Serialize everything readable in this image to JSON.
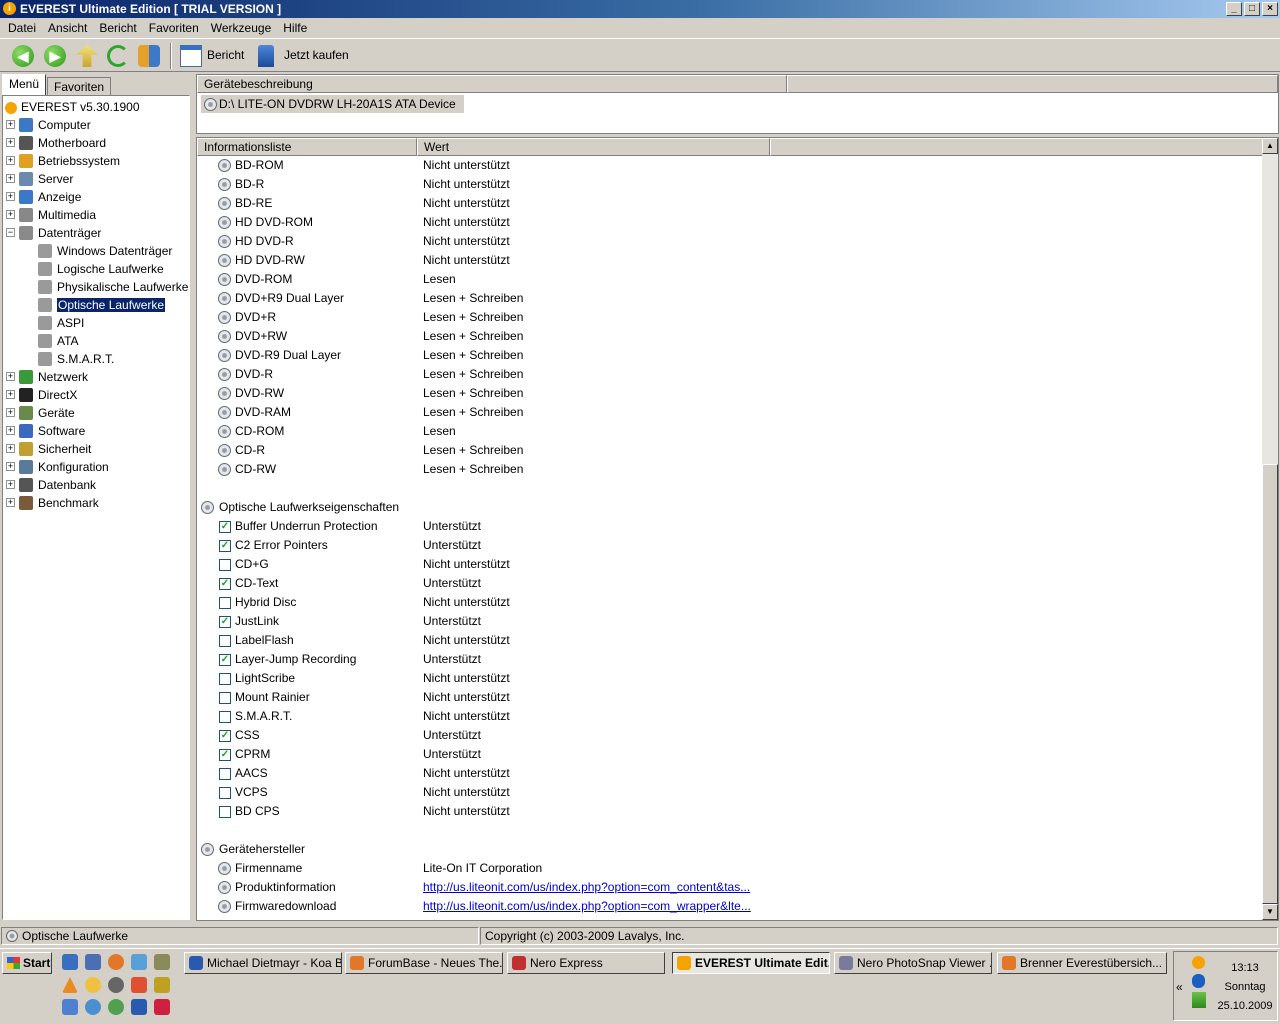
{
  "window": {
    "title": "EVEREST Ultimate Edition  [ TRIAL VERSION ]"
  },
  "menu": [
    "Datei",
    "Ansicht",
    "Bericht",
    "Favoriten",
    "Werkzeuge",
    "Hilfe"
  ],
  "toolbar": {
    "report_label": "Bericht",
    "buy_label": "Jetzt kaufen"
  },
  "left_tabs": [
    "Menü",
    "Favoriten"
  ],
  "tree": {
    "root": "EVEREST v5.30.1900",
    "items": [
      "Computer",
      "Motherboard",
      "Betriebssystem",
      "Server",
      "Anzeige",
      "Multimedia",
      "Datenträger"
    ],
    "sub_items": [
      "Windows Datenträger",
      "Logische Laufwerke",
      "Physikalische Laufwerke",
      "Optische Laufwerke",
      "ASPI",
      "ATA",
      "S.M.A.R.T."
    ],
    "items_after": [
      "Netzwerk",
      "DirectX",
      "Geräte",
      "Software",
      "Sicherheit",
      "Konfiguration",
      "Datenbank",
      "Benchmark"
    ]
  },
  "device_panel": {
    "header": "Gerätebeschreibung",
    "device": "D:\\  LITE-ON DVDRW LH-20A1S ATA Device"
  },
  "list": {
    "col_name": "Informationsliste",
    "col_value": "Wert",
    "media": [
      {
        "name": "BD-ROM",
        "value": "Nicht unterstützt"
      },
      {
        "name": "BD-R",
        "value": "Nicht unterstützt"
      },
      {
        "name": "BD-RE",
        "value": "Nicht unterstützt"
      },
      {
        "name": "HD DVD-ROM",
        "value": "Nicht unterstützt"
      },
      {
        "name": "HD DVD-R",
        "value": "Nicht unterstützt"
      },
      {
        "name": "HD DVD-RW",
        "value": "Nicht unterstützt"
      },
      {
        "name": "DVD-ROM",
        "value": "Lesen"
      },
      {
        "name": "DVD+R9 Dual Layer",
        "value": "Lesen + Schreiben"
      },
      {
        "name": "DVD+R",
        "value": "Lesen + Schreiben"
      },
      {
        "name": "DVD+RW",
        "value": "Lesen + Schreiben"
      },
      {
        "name": "DVD-R9 Dual Layer",
        "value": "Lesen + Schreiben"
      },
      {
        "name": "DVD-R",
        "value": "Lesen + Schreiben"
      },
      {
        "name": "DVD-RW",
        "value": "Lesen + Schreiben"
      },
      {
        "name": "DVD-RAM",
        "value": "Lesen + Schreiben"
      },
      {
        "name": "CD-ROM",
        "value": "Lesen"
      },
      {
        "name": "CD-R",
        "value": "Lesen + Schreiben"
      },
      {
        "name": "CD-RW",
        "value": "Lesen + Schreiben"
      }
    ],
    "features_title": "Optische Laufwerkseigenschaften",
    "features": [
      {
        "name": "Buffer Underrun Protection",
        "value": "Unterstützt",
        "checked": true
      },
      {
        "name": "C2 Error Pointers",
        "value": "Unterstützt",
        "checked": true
      },
      {
        "name": "CD+G",
        "value": "Nicht unterstützt",
        "checked": false
      },
      {
        "name": "CD-Text",
        "value": "Unterstützt",
        "checked": true
      },
      {
        "name": "Hybrid Disc",
        "value": "Nicht unterstützt",
        "checked": false
      },
      {
        "name": "JustLink",
        "value": "Unterstützt",
        "checked": true
      },
      {
        "name": "LabelFlash",
        "value": "Nicht unterstützt",
        "checked": false
      },
      {
        "name": "Layer-Jump Recording",
        "value": "Unterstützt",
        "checked": true
      },
      {
        "name": "LightScribe",
        "value": "Nicht unterstützt",
        "checked": false
      },
      {
        "name": "Mount Rainier",
        "value": "Nicht unterstützt",
        "checked": false
      },
      {
        "name": "S.M.A.R.T.",
        "value": "Nicht unterstützt",
        "checked": false
      },
      {
        "name": "CSS",
        "value": "Unterstützt",
        "checked": true
      },
      {
        "name": "CPRM",
        "value": "Unterstützt",
        "checked": true
      },
      {
        "name": "AACS",
        "value": "Nicht unterstützt",
        "checked": false
      },
      {
        "name": "VCPS",
        "value": "Nicht unterstützt",
        "checked": false
      },
      {
        "name": "BD CPS",
        "value": "Nicht unterstützt",
        "checked": false
      }
    ],
    "vendor_title": "Gerätehersteller",
    "vendor": [
      {
        "name": "Firmenname",
        "value": "Lite-On IT Corporation",
        "link": false
      },
      {
        "name": "Produktinformation",
        "value": "http://us.liteonit.com/us/index.php?option=com_content&tas...",
        "link": true
      },
      {
        "name": "Firmwaredownload",
        "value": "http://us.liteonit.com/us/index.php?option=com_wrapper&lte...",
        "link": true
      }
    ]
  },
  "status": {
    "left": "Optische Laufwerke",
    "right": "Copyright (c) 2003-2009 Lavalys, Inc."
  },
  "taskbar": {
    "start": "Start",
    "tasks": [
      "Michael Dietmayr - Koa Bi...",
      "ForumBase - Neues The...",
      "Nero Express",
      "EVEREST Ultimate Edit...",
      "Nero PhotoSnap Viewer ...",
      "Brenner Everestübersich..."
    ],
    "active_task": 3,
    "clock": {
      "time": "13:13",
      "day": "Sonntag",
      "date": "25.10.2009"
    }
  }
}
